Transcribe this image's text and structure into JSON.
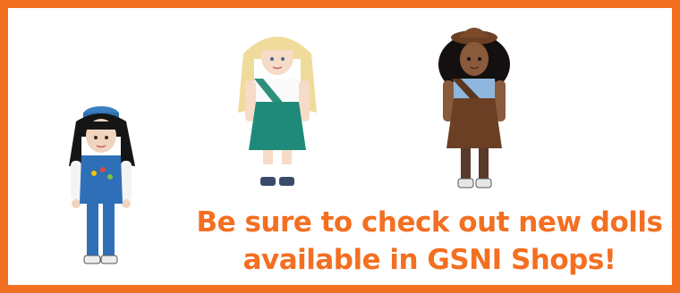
{
  "promo": {
    "line1": "Be sure to check out new dolls",
    "line2": "available in GSNI Shops!"
  },
  "colors": {
    "border": "#f36f21",
    "text": "#f36f21"
  },
  "images": [
    {
      "name": "daisy-doll-image",
      "description": "doll in blue uniform"
    },
    {
      "name": "junior-doll-image",
      "description": "blonde doll in green uniform"
    },
    {
      "name": "brownie-doll-image",
      "description": "doll in brown uniform"
    }
  ]
}
